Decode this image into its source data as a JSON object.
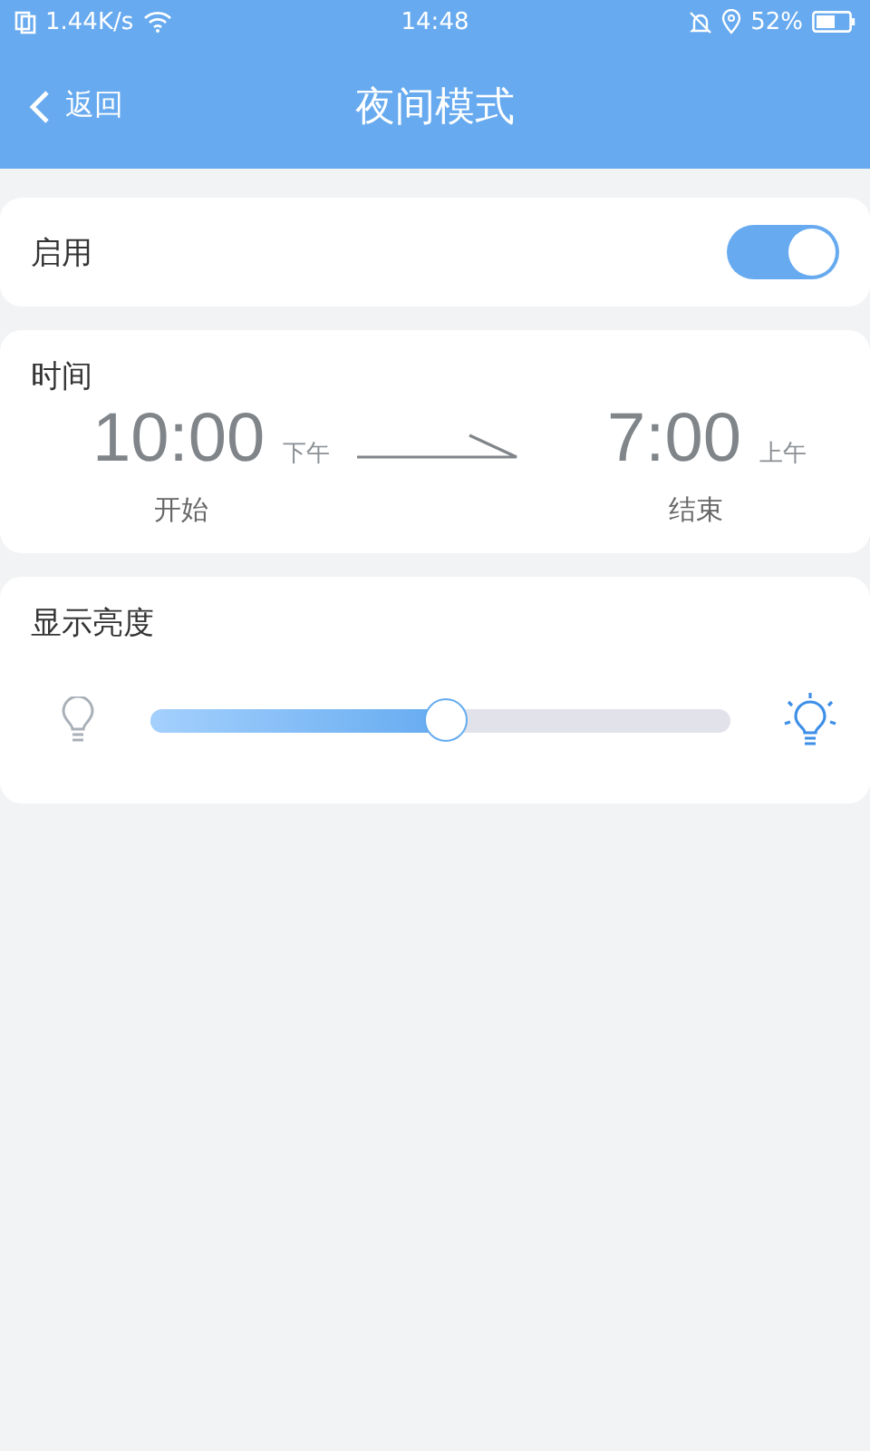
{
  "status_bar": {
    "speed": "1.44K/s",
    "time": "14:48",
    "battery": "52%"
  },
  "header": {
    "back": "返回",
    "title": "夜间模式"
  },
  "enable": {
    "label": "启用",
    "on": true
  },
  "time": {
    "title": "时间",
    "start": {
      "time": "10:00",
      "period": "下午",
      "label": "开始"
    },
    "end": {
      "time": "7:00",
      "period": "上午",
      "label": "结束"
    }
  },
  "brightness": {
    "title": "显示亮度",
    "level": 0.51
  }
}
